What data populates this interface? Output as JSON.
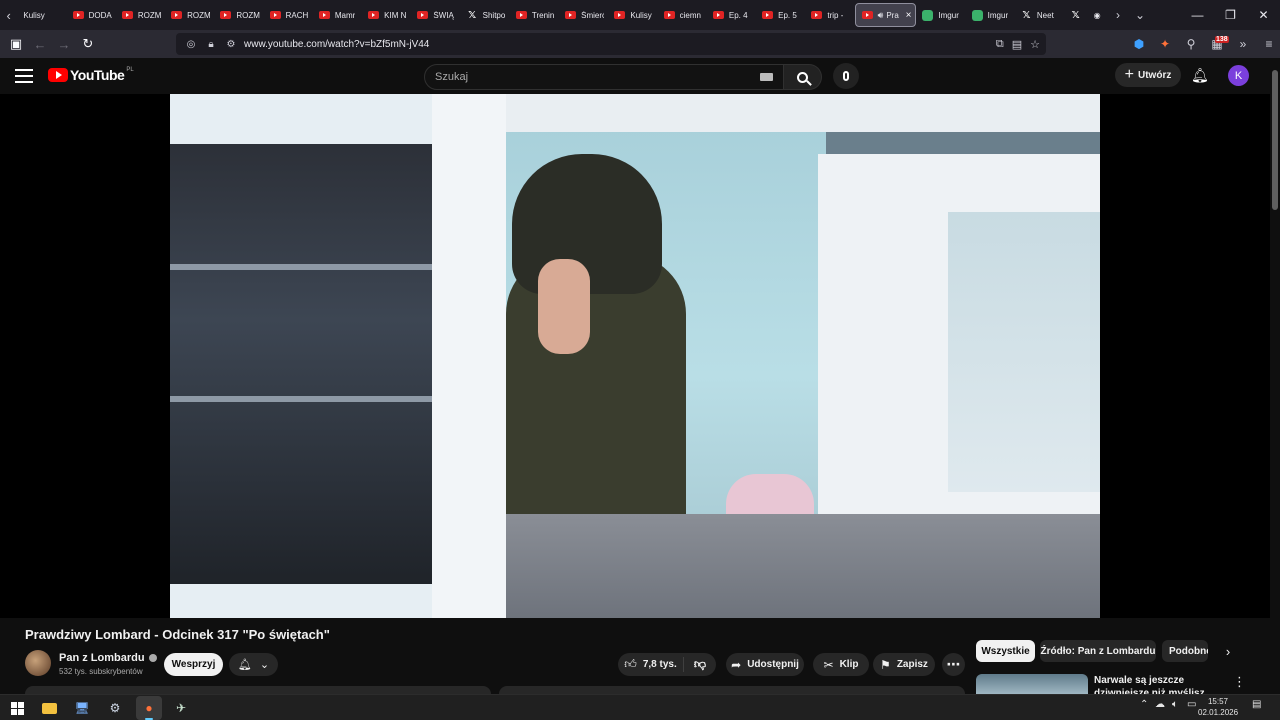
{
  "browser": {
    "tabs": [
      {
        "label": "Kulisy",
        "icon": "none"
      },
      {
        "label": "DODA",
        "icon": "youtube"
      },
      {
        "label": "ROZM",
        "icon": "youtube"
      },
      {
        "label": "ROZM",
        "icon": "youtube"
      },
      {
        "label": "ROZM",
        "icon": "youtube"
      },
      {
        "label": "RACH",
        "icon": "youtube"
      },
      {
        "label": "Mamr",
        "icon": "youtube"
      },
      {
        "label": "KIM N",
        "icon": "youtube"
      },
      {
        "label": "ŚWIĄ",
        "icon": "youtube"
      },
      {
        "label": "Shitpo",
        "icon": "x"
      },
      {
        "label": "Trenin",
        "icon": "youtube"
      },
      {
        "label": "Śmierć",
        "icon": "youtube"
      },
      {
        "label": "Kulisy",
        "icon": "youtube"
      },
      {
        "label": "ciemn",
        "icon": "youtube"
      },
      {
        "label": "Ep. 4",
        "icon": "youtube"
      },
      {
        "label": "Ep. 5",
        "icon": "youtube"
      },
      {
        "label": "trip -",
        "icon": "youtube"
      }
    ],
    "active_tab": {
      "label": "Pra",
      "close": "×"
    },
    "trailing_tabs": [
      {
        "label": "Imgur",
        "icon": "imgur"
      },
      {
        "label": "Imgur",
        "icon": "imgur"
      },
      {
        "label": "Neet",
        "icon": "x"
      }
    ],
    "url": "www.youtube.com/watch?v=bZf5mN-jV44",
    "extension_badge": "138"
  },
  "youtube": {
    "logo_text": "YouTube",
    "region": "PL",
    "search_placeholder": "Szukaj",
    "create_label": "Utwórz",
    "avatar_letter": "K"
  },
  "video": {
    "title": "Prawdziwy Lombard - Odcinek 317 \"Po świętach\"",
    "channel": "Pan z Lombardu",
    "subscribers": "532 tys. subskrybentów",
    "support_label": "Wesprzyj",
    "likes": "7,8 tys.",
    "share_label": "Udostępnij",
    "clip_label": "Klip",
    "save_label": "Zapisz"
  },
  "sidebar": {
    "chips": [
      "Wszystkie",
      "Źródło: Pan z Lombardu",
      "Podobne"
    ],
    "recommendation_title": "Narwale są jeszcze dziwniejsze niż myślisz"
  },
  "taskbar": {
    "time": "15:57",
    "date": "02.01.2026"
  },
  "colors": {
    "yt_red": "#ff0000",
    "page_bg": "#0f0f0f",
    "button_bg": "#272727",
    "avatar": "#7b3fdc",
    "firefox_accent": "#60cdff"
  }
}
